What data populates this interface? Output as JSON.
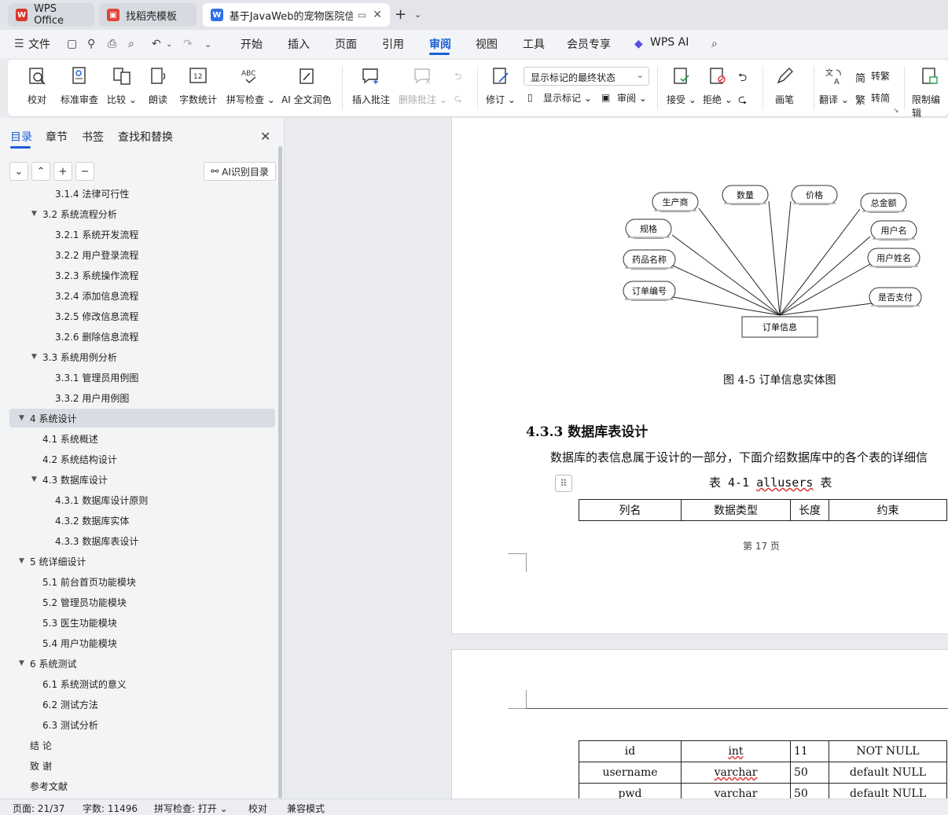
{
  "tabs": [
    {
      "label": "WPS Office"
    },
    {
      "label": "找稻壳模板"
    },
    {
      "label": "基于JavaWeb的宠物医院信息"
    }
  ],
  "menu": {
    "file": "文件",
    "items": [
      "开始",
      "插入",
      "页面",
      "引用",
      "审阅",
      "视图",
      "工具",
      "会员专享",
      "WPS AI"
    ],
    "active": "审阅"
  },
  "ribbon": {
    "proofread": "校对",
    "standard_review": "标准审查",
    "compare": "比较",
    "read_aloud": "朗读",
    "word_count": "字数统计",
    "spell_check": "拼写检查",
    "ai_polish": "AI 全文润色",
    "insert_comment": "插入批注",
    "delete_comment": "删除批注",
    "track_changes": "修订",
    "markup_select": "显示标记的最终状态",
    "show_markup": "显示标记",
    "review": "审阅",
    "accept": "接受",
    "reject": "拒绝",
    "pen": "画笔",
    "translate": "翻译",
    "to_traditional": "转繁",
    "to_simplified": "转简",
    "restrict_edit": "限制编辑"
  },
  "nav": {
    "tabs": [
      "目录",
      "章节",
      "书签",
      "查找和替换"
    ],
    "ai_toc_label": "AI识别目录",
    "toc": [
      {
        "text": "3.1.4  法律可行性",
        "level": 3
      },
      {
        "text": "3.2 系统流程分析",
        "level": 2,
        "expanded": true
      },
      {
        "text": "3.2.1 系统开发流程",
        "level": 3
      },
      {
        "text": "3.2.2  用户登录流程",
        "level": 3
      },
      {
        "text": "3.2.3  系统操作流程",
        "level": 3
      },
      {
        "text": "3.2.4  添加信息流程",
        "level": 3
      },
      {
        "text": "3.2.5  修改信息流程",
        "level": 3
      },
      {
        "text": "3.2.6  删除信息流程",
        "level": 3
      },
      {
        "text": "3.3 系统用例分析",
        "level": 2,
        "expanded": true
      },
      {
        "text": "3.3.1 管理员用例图",
        "level": 3
      },
      {
        "text": "3.3.2 用户用例图",
        "level": 3
      },
      {
        "text": "4  系统设计",
        "level": 1,
        "expanded": true,
        "selected": true
      },
      {
        "text": "4.1  系统概述",
        "level": 2
      },
      {
        "text": "4.2  系统结构设计",
        "level": 2
      },
      {
        "text": "4.3 数据库设计",
        "level": 2,
        "expanded": true
      },
      {
        "text": "4.3.1  数据库设计原则",
        "level": 3
      },
      {
        "text": "4.3.2  数据库实体",
        "level": 3
      },
      {
        "text": "4.3.3  数据库表设计",
        "level": 3
      },
      {
        "text": "5 统详细设计",
        "level": 1,
        "expanded": true
      },
      {
        "text": "5.1 前台首页功能模块",
        "level": 2
      },
      {
        "text": "5.2 管理员功能模块",
        "level": 2
      },
      {
        "text": "5.3 医生功能模块",
        "level": 2
      },
      {
        "text": "5.4 用户功能模块",
        "level": 2
      },
      {
        "text": "6 系统测试",
        "level": 1,
        "expanded": true
      },
      {
        "text": "6.1 系统测试的意义",
        "level": 2
      },
      {
        "text": "6.2  测试方法",
        "level": 2
      },
      {
        "text": "6.3 测试分析",
        "level": 2
      },
      {
        "text": "结      论",
        "level": 1
      },
      {
        "text": "致      谢",
        "level": 1
      },
      {
        "text": "参考文献",
        "level": 1
      }
    ]
  },
  "doc": {
    "diagram": {
      "center": "订单信息",
      "attributes": [
        "生产商",
        "数量",
        "价格",
        "总金额",
        "规格",
        "用户名",
        "药品名称",
        "用户姓名",
        "订单编号",
        "是否支付"
      ]
    },
    "figure_caption": "图 4-5 订单信息实体图",
    "section_heading": "4.3.3  数据库表设计",
    "body": "数据库的表信息属于设计的一部分，下面介绍数据库中的各个表的详细信",
    "table_title_prefix": "表 4-1 ",
    "table_title_name": "allusers",
    "table_title_suffix": " 表",
    "table_header": [
      "列名",
      "数据类型",
      "长度",
      "约束"
    ],
    "page_number": "第 17 页",
    "table_rows": [
      [
        "id",
        "int",
        "11",
        "NOT NULL"
      ],
      [
        "username",
        "varchar",
        "50",
        "default NULL"
      ],
      [
        "pwd",
        "varchar",
        "50",
        "default NULL"
      ]
    ]
  },
  "status": {
    "page": "页面: 21/37",
    "words": "字数: 11496",
    "spell": "拼写检查: 打开",
    "proof": "校对",
    "compat": "兼容模式"
  },
  "colors": {
    "accent": "#1a5fd8",
    "wps_red": "#d8372c"
  }
}
